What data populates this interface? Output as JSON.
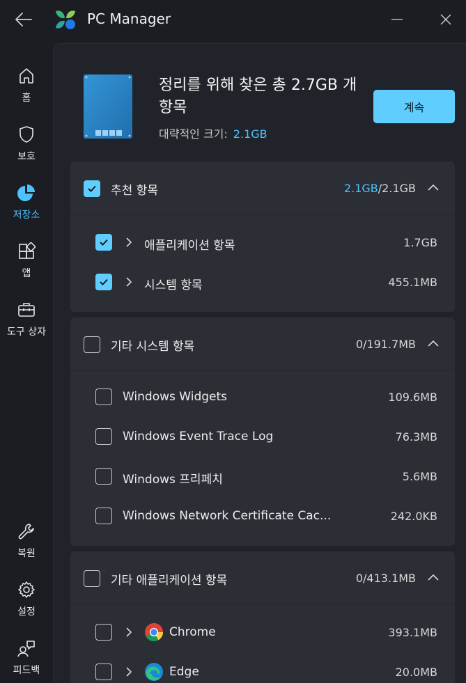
{
  "app": {
    "title": "PC Manager"
  },
  "nav": [
    {
      "id": "home",
      "label": "홈",
      "icon": "home-icon"
    },
    {
      "id": "protect",
      "label": "보호",
      "icon": "shield-icon"
    },
    {
      "id": "storage",
      "label": "저장소",
      "icon": "pie-chart-icon",
      "active": true
    },
    {
      "id": "apps",
      "label": "앱",
      "icon": "apps-grid-icon"
    },
    {
      "id": "toolbox",
      "label": "도구 상자",
      "icon": "toolbox-icon"
    },
    {
      "id": "restore",
      "label": "복원",
      "icon": "wrench-icon"
    },
    {
      "id": "settings",
      "label": "설정",
      "icon": "gear-icon"
    },
    {
      "id": "feedback",
      "label": "피드백",
      "icon": "feedback-icon"
    }
  ],
  "summary": {
    "title": "정리를 위해 찾은 총 2.7GB 개 항목",
    "size_label": "대략적인 크기:",
    "size_value": "2.1GB",
    "continue_label": "계속"
  },
  "sections": [
    {
      "title": "추천 항목",
      "size_selected": "2.1GB",
      "size_total": "/2.1GB",
      "checked": true,
      "items": [
        {
          "label": "애플리케이션 항목",
          "size": "1.7GB",
          "checked": true,
          "expandable": true
        },
        {
          "label": "시스템 항목",
          "size": "455.1MB",
          "checked": true,
          "expandable": true
        }
      ]
    },
    {
      "title": "기타 시스템 항목",
      "size_selected": "0",
      "size_total": "/191.7MB",
      "checked": false,
      "items": [
        {
          "label": "Windows Widgets",
          "size": "109.6MB",
          "checked": false
        },
        {
          "label": "Windows Event Trace Log",
          "size": "76.3MB",
          "checked": false
        },
        {
          "label": "Windows 프리페치",
          "size": "5.6MB",
          "checked": false
        },
        {
          "label": "Windows Network Certificate Cac...",
          "size": "242.0KB",
          "checked": false
        }
      ]
    },
    {
      "title": "기타 애플리케이션 항목",
      "size_selected": "0",
      "size_total": "/413.1MB",
      "checked": false,
      "items": [
        {
          "label": "Chrome",
          "size": "393.1MB",
          "checked": false,
          "expandable": true,
          "icon": "chrome-icon"
        },
        {
          "label": "Edge",
          "size": "20.0MB",
          "checked": false,
          "expandable": true,
          "icon": "edge-icon"
        }
      ]
    }
  ],
  "colors": {
    "accent": "#60cdff",
    "accent_text": "#4cc2ff",
    "window_bg": "#1b1d23",
    "panel_bg": "#202329",
    "card_bg": "#2b2e35"
  }
}
